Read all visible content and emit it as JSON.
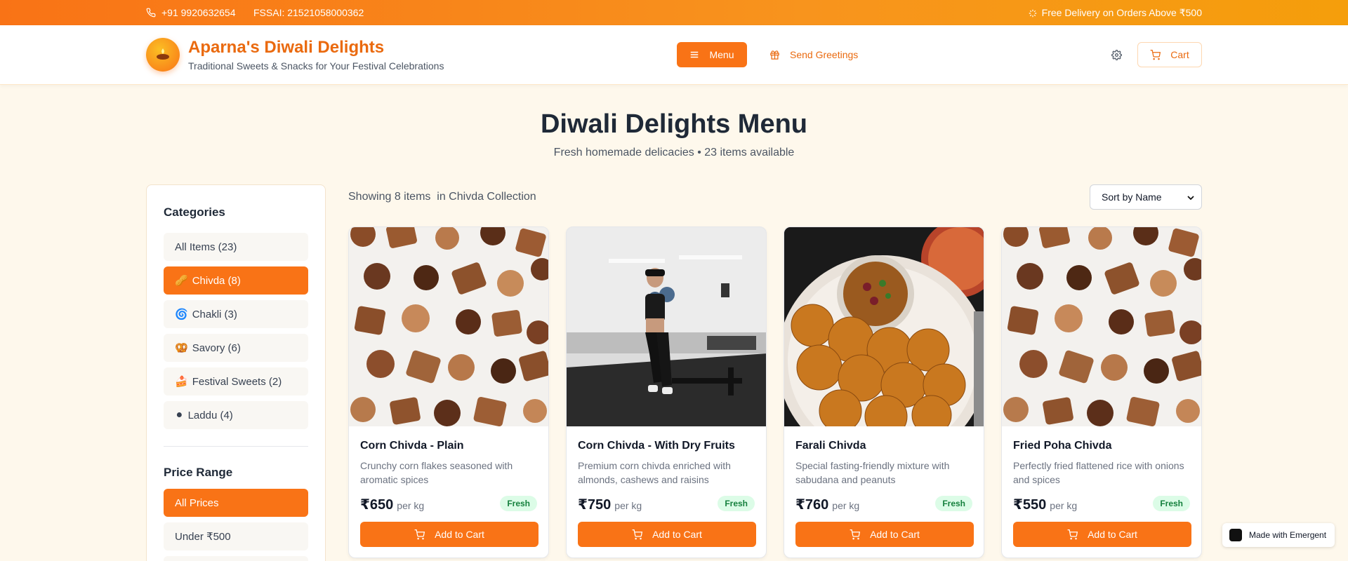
{
  "topbar": {
    "phone": "+91 9920632654",
    "fssai": "FSSAI: 21521058000362",
    "delivery": "Free Delivery on Orders Above ₹500"
  },
  "header": {
    "brand_title": "Aparna's Diwali Delights",
    "brand_subtitle": "Traditional Sweets & Snacks for Your Festival Celebrations",
    "menu_label": "Menu",
    "greetings_label": "Send Greetings",
    "cart_label": "Cart"
  },
  "hero": {
    "title": "Diwali Delights Menu",
    "subtitle": "Fresh homemade delicacies • 23 items available"
  },
  "sidebar": {
    "categories_heading": "Categories",
    "categories": [
      {
        "icon": "",
        "label": "All Items (23)",
        "active": false
      },
      {
        "icon": "🥜",
        "label": "Chivda (8)",
        "active": true
      },
      {
        "icon": "🌀",
        "label": "Chakli (3)",
        "active": false
      },
      {
        "icon": "🥨",
        "label": "Savory (6)",
        "active": false
      },
      {
        "icon": "🍰",
        "label": "Festival Sweets (2)",
        "active": false
      },
      {
        "icon": "⚫",
        "label": "Laddu (4)",
        "active": false
      }
    ],
    "price_heading": "Price Range",
    "prices": [
      {
        "label": "All Prices",
        "active": true
      },
      {
        "label": "Under ₹500",
        "active": false
      }
    ]
  },
  "toolbar": {
    "showing": "Showing 8 items  in Chivda Collection",
    "sort_value": "Sort by Name"
  },
  "products": [
    {
      "name": "Corn Chivda - Plain",
      "desc": "Crunchy corn flakes seasoned with aromatic spices",
      "price": "₹650",
      "unit": "per kg",
      "badge": "Fresh",
      "cta": "Add to Cart",
      "image": "chocolates"
    },
    {
      "name": "Corn Chivda - With Dry Fruits",
      "desc": "Premium corn chivda enriched with almonds, cashews and raisins",
      "price": "₹750",
      "unit": "per kg",
      "badge": "Fresh",
      "cta": "Add to Cart",
      "image": "gym"
    },
    {
      "name": "Farali Chivda",
      "desc": "Special fasting-friendly mixture with sabudana and peanuts",
      "price": "₹760",
      "unit": "per kg",
      "badge": "Fresh",
      "cta": "Add to Cart",
      "image": "pav-bhaji"
    },
    {
      "name": "Fried Poha Chivda",
      "desc": "Perfectly fried flattened rice with onions and spices",
      "price": "₹550",
      "unit": "per kg",
      "badge": "Fresh",
      "cta": "Add to Cart",
      "image": "chocolates"
    }
  ],
  "badge_widget": {
    "label": "Made with Emergent"
  },
  "colors": {
    "accent": "#f97316",
    "accent_text": "#ea6a0f",
    "background": "#fef8ec",
    "fresh_bg": "#dcfce7",
    "fresh_text": "#15803d"
  }
}
